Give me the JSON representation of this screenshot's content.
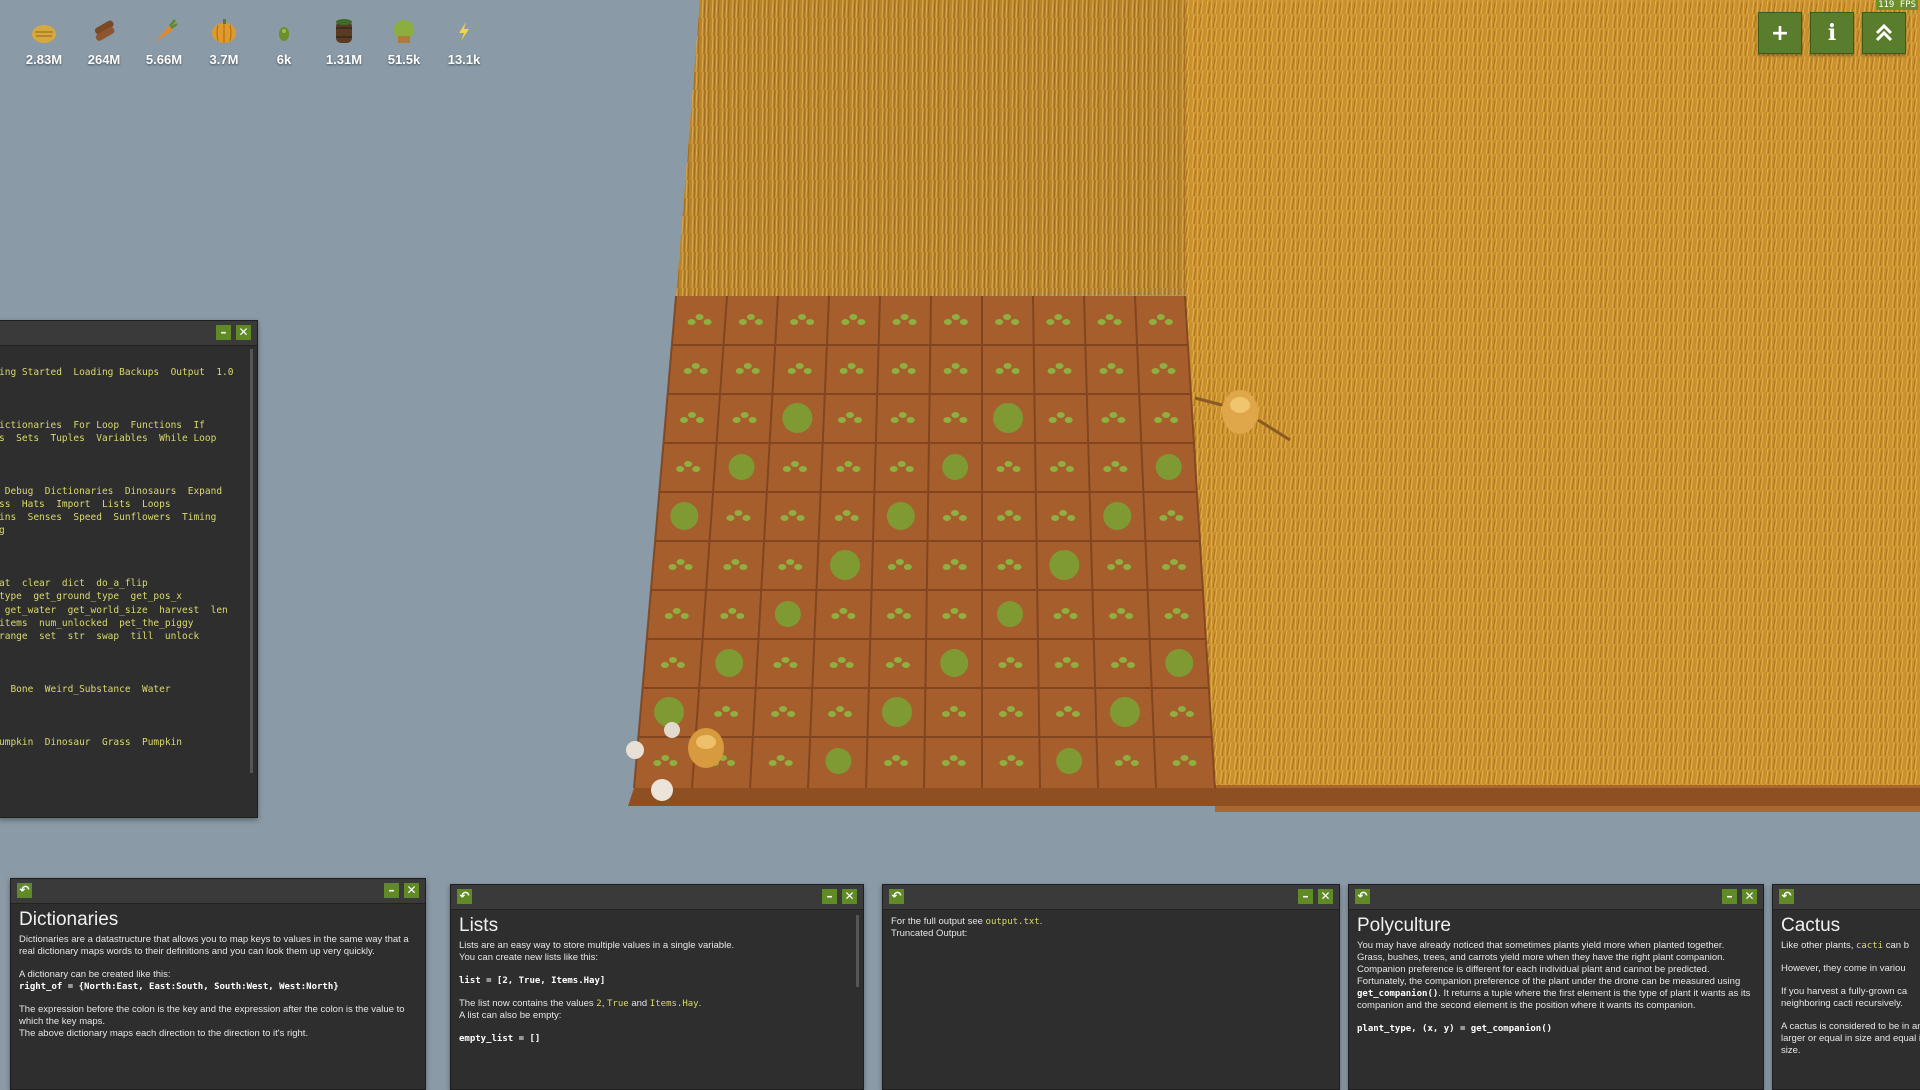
{
  "hud": {
    "fps": "119 FPS",
    "resources": [
      {
        "icon": "hay-icon",
        "value": "2.83M"
      },
      {
        "icon": "wood-icon",
        "value": "264M"
      },
      {
        "icon": "carrot-icon",
        "value": "5.66M"
      },
      {
        "icon": "pumpkin-icon",
        "value": "3.7M"
      },
      {
        "icon": "cactus-icon",
        "value": "6k"
      },
      {
        "icon": "barrel-icon",
        "value": "1.31M"
      },
      {
        "icon": "bush-icon",
        "value": "51.5k"
      },
      {
        "icon": "power-icon",
        "value": "13.1k"
      }
    ],
    "buttons": {
      "add": "+",
      "info": "i",
      "up": "⌃"
    }
  },
  "editor": {
    "lines": [
      "ing Started  Loading Backups  Output  1.0",
      "",
      "",
      "",
      "ictionaries  For Loop  Functions  If",
      "s  Sets  Tuples  Variables  While Loop",
      "",
      "",
      "",
      " Debug  Dictionaries  Dinosaurs  Expand",
      "ss  Hats  Import  Lists  Loops",
      "ins  Senses  Speed  Sunflowers  Timing",
      "g",
      "",
      "",
      "",
      "at  clear  dict  do_a_flip",
      "type  get_ground_type  get_pos_x",
      " get_water  get_world_size  harvest  len",
      "items  num_unlocked  pet_the_piggy",
      "range  set  str  swap  till  unlock",
      "",
      "",
      "",
      "  Bone  Weird_Substance  Water",
      "",
      "",
      "",
      "umpkin  Dinosaur  Grass  Pumpkin"
    ]
  },
  "panels": {
    "dictionaries": {
      "title": "Dictionaries",
      "p1": "Dictionaries are a datastructure that allows you to map keys to values in the same way that a real dictionary maps words to their definitions and you can look them up very quickly.",
      "p2": "A dictionary can be created like this:",
      "code1": "right_of = {North:East, East:South, South:West, West:North}",
      "p3": "The expression before the colon is the key and the expression after the colon is the value to which the key maps.",
      "p4": "The above dictionary maps each direction to the direction to it's right."
    },
    "lists": {
      "title": "Lists",
      "p1": "Lists are an easy way to store multiple values in a single variable.",
      "p2": "You can create new lists like this:",
      "code1": "list = [2, True, Items.Hay]",
      "p3_a": "The list now contains the values ",
      "p3_b": "2",
      "p3_c": ", ",
      "p3_d": "True",
      "p3_e": " and ",
      "p3_f": "Items.Hay",
      "p3_g": ".",
      "p4": "A list can also be empty:",
      "code2": "empty_list = []"
    },
    "output": {
      "line1_a": "For the full output see ",
      "line1_b": "output.txt",
      "line1_c": ".",
      "line2": "Truncated Output:"
    },
    "polyculture": {
      "title": "Polyculture",
      "p1": "You may have already noticed that sometimes plants yield more when planted together.",
      "p2": "Grass, bushes, trees, and carrots yield more when they have the right plant companion. Companion preference is different for each individual plant and cannot be predicted. Fortunately, the companion preference of the plant under the drone can be measured using ",
      "p2_code": "get_companion()",
      "p2_end": ". It returns a tuple where the first element is the type of plant it wants as its companion and the second element is the position where it wants its companion.",
      "code1": "plant_type, (x, y) = get_companion()"
    },
    "cactus": {
      "title": "Cactus",
      "p1_a": "Like other plants, ",
      "p1_b": "cacti",
      "p1_c": " can b",
      "p2": "However, they come in variou",
      "p3": "If you harvest a fully-grown ca neighboring cacti recursively.",
      "p4": "A cactus is considered to be in and larger or equal in size and equal in size."
    }
  }
}
